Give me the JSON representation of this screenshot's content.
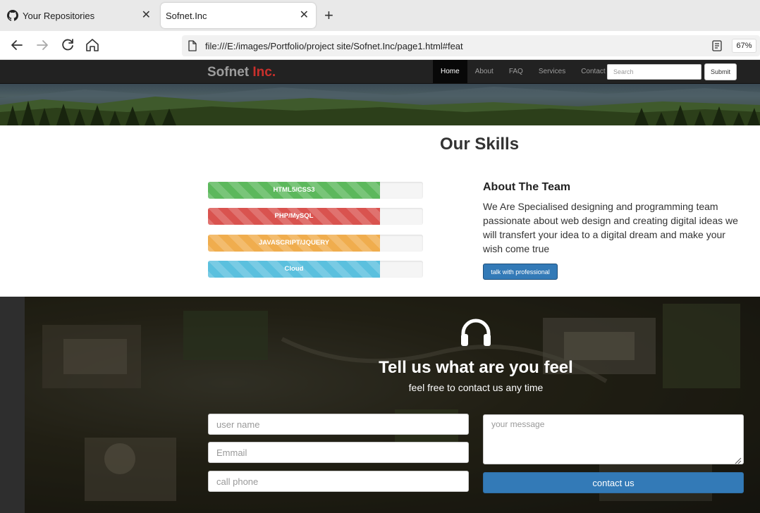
{
  "browser": {
    "tabs": [
      {
        "title": "Your Repositories",
        "icon": "github-icon",
        "active": false
      },
      {
        "title": "Sofnet.Inc",
        "icon": "",
        "active": true
      }
    ],
    "url": "file:///E:/images/Portfolio/project site/Sofnet.Inc/page1.html#feat",
    "zoom": "67%"
  },
  "site": {
    "brand_primary": "Sofnet",
    "brand_accent": "Inc.",
    "nav": [
      "Home",
      "About",
      "FAQ",
      "Services",
      "Contact"
    ],
    "active_nav": "Home",
    "search_placeholder": "Search",
    "submit_label": "Submit"
  },
  "skills": {
    "title": "Our Skills",
    "bars": [
      {
        "label": "HTML5/CSS3",
        "percent": 80,
        "color": "#5cb85c"
      },
      {
        "label": "PHP/MySQL",
        "percent": 80,
        "color": "#d9534f"
      },
      {
        "label": "JAVASCRIPT/JQUERY",
        "percent": 80,
        "color": "#f0ad4e"
      },
      {
        "label": "Cloud",
        "percent": 80,
        "color": "#5bc0de"
      }
    ]
  },
  "about": {
    "title": "About The Team",
    "text": "We Are Specialised designing and programming team passionate about web design and creating digital ideas we will transfert your idea to a digital dream and make your wish come true",
    "button": "talk with professional"
  },
  "contact": {
    "icon": "headphones-icon",
    "title": "Tell us what are you feel",
    "subtitle": "feel free to contact us any time",
    "username_placeholder": "user name",
    "email_placeholder": "Emmail",
    "phone_placeholder": "call phone",
    "message_placeholder": "your message",
    "button": "contact us"
  },
  "colors": {
    "accent": "#337ab7",
    "brand_accent": "#c9302c",
    "navbar": "#222222"
  }
}
